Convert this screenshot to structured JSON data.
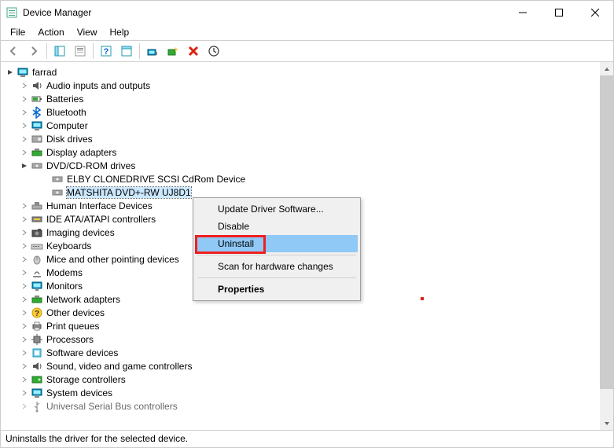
{
  "window": {
    "title": "Device Manager"
  },
  "menu": {
    "file": "File",
    "action": "Action",
    "view": "View",
    "help": "Help"
  },
  "tree": {
    "root": "farrad",
    "items": [
      {
        "label": "Audio inputs and outputs",
        "expanded": false
      },
      {
        "label": "Batteries",
        "expanded": false
      },
      {
        "label": "Bluetooth",
        "expanded": false
      },
      {
        "label": "Computer",
        "expanded": false
      },
      {
        "label": "Disk drives",
        "expanded": false
      },
      {
        "label": "Display adapters",
        "expanded": false
      },
      {
        "label": "DVD/CD-ROM drives",
        "expanded": true,
        "children": [
          {
            "label": "ELBY CLONEDRIVE SCSI CdRom Device",
            "selected": false
          },
          {
            "label": "MATSHITA DVD+-RW UJ8D1",
            "selected": true
          }
        ]
      },
      {
        "label": "Human Interface Devices",
        "expanded": false
      },
      {
        "label": "IDE ATA/ATAPI controllers",
        "expanded": false
      },
      {
        "label": "Imaging devices",
        "expanded": false
      },
      {
        "label": "Keyboards",
        "expanded": false
      },
      {
        "label": "Mice and other pointing devices",
        "expanded": false
      },
      {
        "label": "Modems",
        "expanded": false
      },
      {
        "label": "Monitors",
        "expanded": false
      },
      {
        "label": "Network adapters",
        "expanded": false
      },
      {
        "label": "Other devices",
        "expanded": false
      },
      {
        "label": "Print queues",
        "expanded": false
      },
      {
        "label": "Processors",
        "expanded": false
      },
      {
        "label": "Software devices",
        "expanded": false
      },
      {
        "label": "Sound, video and game controllers",
        "expanded": false
      },
      {
        "label": "Storage controllers",
        "expanded": false
      },
      {
        "label": "System devices",
        "expanded": false
      },
      {
        "label": "Universal Serial Bus controllers",
        "expanded": false
      }
    ]
  },
  "contextMenu": {
    "updateDriver": "Update Driver Software...",
    "disable": "Disable",
    "uninstall": "Uninstall",
    "scan": "Scan for hardware changes",
    "properties": "Properties"
  },
  "status": {
    "text": "Uninstalls the driver for the selected device."
  }
}
